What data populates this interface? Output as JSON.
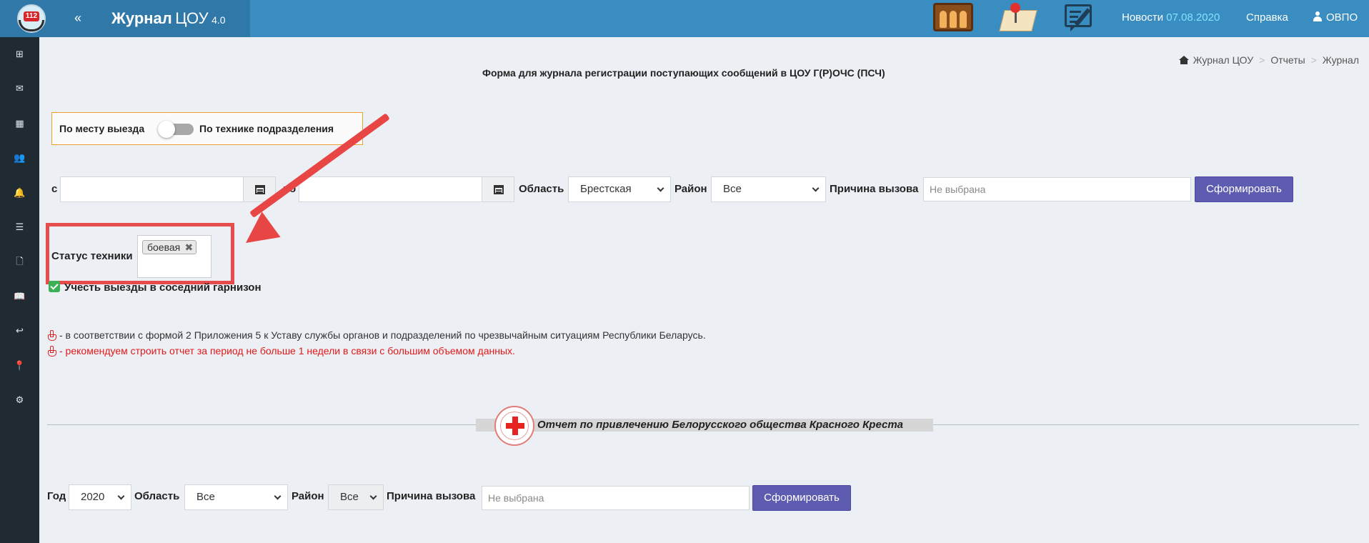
{
  "header": {
    "collapse_label": "«",
    "brand_bold": "Журнал",
    "brand_rest": "ЦОУ",
    "brand_version": "4.0",
    "logo_badge": "112",
    "news_label": "Новости",
    "news_date": "07.08.2020",
    "help_label": "Справка",
    "user_label": "ОВПО"
  },
  "sidebar": {
    "items": [
      {
        "icon": "plus-square-icon",
        "glyph": "⊞"
      },
      {
        "icon": "envelope-icon",
        "glyph": "✉"
      },
      {
        "icon": "table-icon",
        "glyph": "▦"
      },
      {
        "icon": "users-icon",
        "glyph": "👥"
      },
      {
        "icon": "bell-icon",
        "glyph": "🔔"
      },
      {
        "icon": "list-icon",
        "glyph": "☰"
      },
      {
        "icon": "file-icon",
        "glyph": "🗋"
      },
      {
        "icon": "book-icon",
        "glyph": "📖"
      },
      {
        "icon": "reply-icon",
        "glyph": "↩"
      },
      {
        "icon": "map-marker-icon",
        "glyph": "📍"
      },
      {
        "icon": "gear-icon",
        "glyph": "⚙"
      }
    ]
  },
  "breadcrumb": {
    "items": [
      "Журнал ЦОУ",
      "Отчеты",
      "Журнал"
    ],
    "separator": ">"
  },
  "page_title": "Форма для журнала регистрации поступающих сообщений в ЦОУ Г(Р)ОЧС (ПСЧ)",
  "toggle": {
    "left_label": "По месту выезда",
    "right_label": "По технике подразделения"
  },
  "filters": {
    "from_label": "с",
    "from_value": "",
    "to_label": "по",
    "to_value": "",
    "region_label": "Область",
    "region_value": "Брестская",
    "district_label": "Район",
    "district_value": "Все",
    "reason_label": "Причина вызова",
    "reason_placeholder": "Не выбрана",
    "submit_label": "Сформировать"
  },
  "status": {
    "label": "Статус техники",
    "tag": "боевая",
    "tag_remove": "✖"
  },
  "checkbox_label": "Учесть выезды в соседний гарнизон",
  "notes": [
    "- в соответствии с формой 2 Приложения 5 к Уставу службы органов и подразделений по чрезвычайным ситуациям Республики Беларусь.",
    "- рекомендуем строить отчет за период не больше 1 недели в связи с большим объемом данных."
  ],
  "red_cross": {
    "section_title": "Отчет по привлечению Белорусского общества Красного Креста",
    "year_label": "Год",
    "year_value": "2020",
    "region_label": "Область",
    "region_value": "Все",
    "district_label": "Район",
    "district_value": "Все",
    "reason_label": "Причина вызова",
    "reason_placeholder": "Не выбрана",
    "submit_label": "Сформировать"
  },
  "colors": {
    "header": "#3a8dc1",
    "sidebar": "#1f2a33",
    "primary_button": "#5e5cb0",
    "highlight": "#e74c4c",
    "warning_text": "#e01a1a",
    "news_date": "#7fe3ff"
  }
}
